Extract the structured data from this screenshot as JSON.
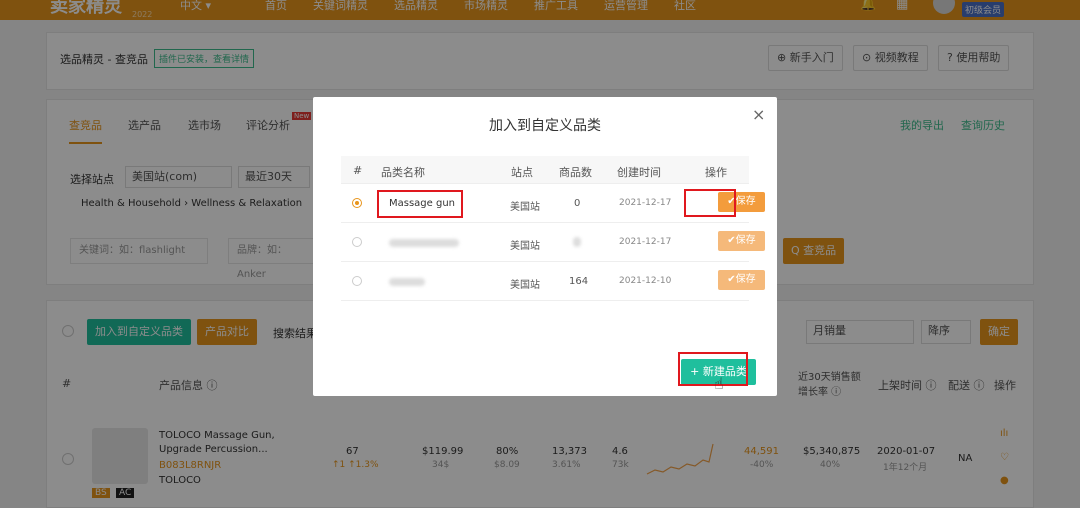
{
  "topbar": {
    "logo": "卖家精灵",
    "logo_sub": "2022",
    "lang": "中文 ▾",
    "nav": [
      "首页",
      "关键词精灵",
      "选品精灵",
      "市场精灵",
      "推广工具",
      "运营管理",
      "社区"
    ],
    "member": "初级会员",
    "bell_icon": "bell-icon",
    "grid_icon": "grid-icon"
  },
  "header": {
    "breadcrumb": "选品精灵 - 查竞品",
    "plugin_note": "插件已安装，查看详情",
    "help": [
      "⊕ 新手入门",
      "⊙ 视频教程",
      "? 使用帮助"
    ]
  },
  "tabs": [
    "查竞品",
    "选产品",
    "选市场",
    "评论分析"
  ],
  "tab_new": "New",
  "tab_links": [
    "我的导出",
    "查询历史"
  ],
  "filters": {
    "site_label": "选择站点",
    "site_value": "美国站(com)",
    "period_value": "最近30天",
    "category_path": "Health & Household › Wellness & Relaxation",
    "keyword_placeholder": "关键词：如：flashlight",
    "brand_placeholder": "品牌：如：Anker",
    "search_button": "Q 查竞品"
  },
  "toolbar": {
    "add_button": "加入到自定义品类",
    "compare_button": "产品对比",
    "result_text": "搜索结果",
    "sort_select": "月销量",
    "order_select": "降序",
    "confirm_button": "确定"
  },
  "table": {
    "headers": [
      "#",
      "产品信息 ⓘ",
      "近30天销售额增长率 ⓘ",
      "上架时间 ⓘ",
      "配送 ⓘ",
      "操作"
    ],
    "row": {
      "title_line1": "TOLOCO Massage Gun,",
      "title_line2": "Upgrade Percussion...",
      "asin": "B083L8RNJR",
      "brand": "TOLOCO",
      "rank": "67",
      "rank_change": "↑1 ↑1.3%",
      "price": "$119.99",
      "price_sub": "34$",
      "fba": "80%",
      "fba_sub": "$8.09",
      "sales": "13,373",
      "sales_sub": "3.61%",
      "rating": "4.6",
      "rating_sub": "73k",
      "units": "44,591",
      "units_sub": "-40%",
      "revenue": "$5,340,875",
      "revenue_sub": "40%",
      "date": "2020-01-07",
      "date_sub": "1年12个月",
      "fulfill": "NA",
      "tags": [
        "BS",
        "AC"
      ]
    }
  },
  "modal": {
    "title": "加入到自定义品类",
    "headers": [
      "#",
      "品类名称",
      "站点",
      "商品数",
      "创建时间",
      "操作"
    ],
    "rows": [
      {
        "name": "Massage gun",
        "site": "美国站",
        "count": "0",
        "date": "2021-12-17",
        "action": "✔保存",
        "selected": true
      },
      {
        "name": "",
        "site": "美国站",
        "count": "",
        "date": "2021-12-17",
        "action": "✔保存",
        "selected": false
      },
      {
        "name": "",
        "site": "美国站",
        "count": "164",
        "date": "2021-12-10",
        "action": "✔保存",
        "selected": false
      }
    ],
    "new_button": "+ 新建品类",
    "close_icon": "×"
  },
  "colors": {
    "accent": "#e8951c",
    "green": "#3cbc8d",
    "teal": "#1fbf9d",
    "highlight": "#e0181e"
  }
}
